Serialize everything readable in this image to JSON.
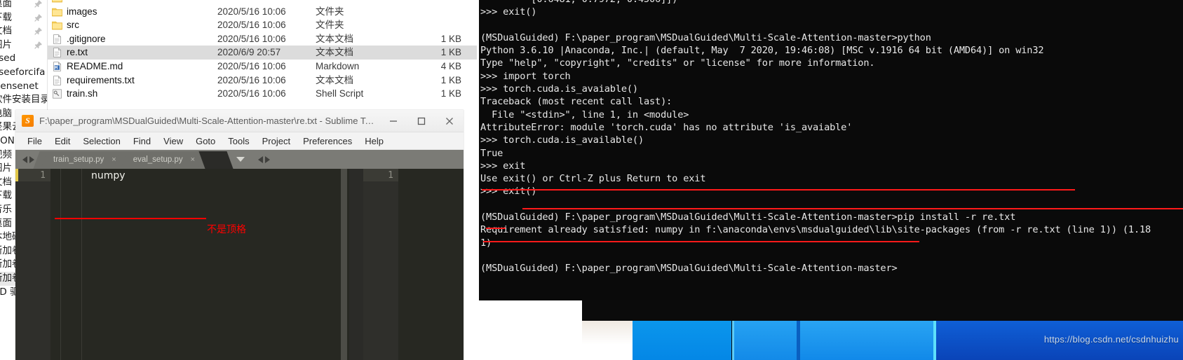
{
  "explorer": {
    "nav_items": [
      {
        "label": "桌面",
        "pinned": true,
        "selected": false
      },
      {
        "label": "下载",
        "pinned": true,
        "selected": false
      },
      {
        "label": "文档",
        "pinned": true,
        "selected": false
      },
      {
        "label": "图片",
        "pinned": true,
        "selected": false
      },
      {
        "label": "ased",
        "pinned": false,
        "selected": false
      },
      {
        "label": "aseeforcifa",
        "pinned": false,
        "selected": false
      },
      {
        "label": "Densenet",
        "pinned": false,
        "selected": false
      },
      {
        "label": "软件安装目录",
        "pinned": false,
        "selected": false
      },
      {
        "label": "电脑",
        "pinned": false,
        "selected": false
      },
      {
        "label": "坚果云",
        "pinned": false,
        "selected": false
      },
      {
        "label": "HON",
        "pinned": false,
        "selected": false
      },
      {
        "label": "视频",
        "pinned": false,
        "selected": false
      },
      {
        "label": "图片",
        "pinned": false,
        "selected": false
      },
      {
        "label": "文档",
        "pinned": false,
        "selected": false
      },
      {
        "label": "下载",
        "pinned": false,
        "selected": false
      },
      {
        "label": "音乐",
        "pinned": false,
        "selected": false
      },
      {
        "label": "桌面",
        "pinned": false,
        "selected": false
      },
      {
        "label": "本地磁盘",
        "pinned": false,
        "selected": false
      },
      {
        "label": "新加卷",
        "pinned": false,
        "selected": false
      },
      {
        "label": "新加卷",
        "pinned": false,
        "selected": false
      },
      {
        "label": "新加卷",
        "pinned": false,
        "selected": true
      },
      {
        "label": "CD 驱动器",
        "pinned": false,
        "selected": false
      }
    ],
    "files": [
      {
        "name": "",
        "date": "",
        "type": "",
        "size": "",
        "icon": "folder-icon",
        "selected": false,
        "partial": true
      },
      {
        "name": "images",
        "date": "2020/5/16 10:06",
        "type": "文件夹",
        "size": "",
        "icon": "folder-icon",
        "selected": false
      },
      {
        "name": "src",
        "date": "2020/5/16 10:06",
        "type": "文件夹",
        "size": "",
        "icon": "folder-icon",
        "selected": false
      },
      {
        "name": ".gitignore",
        "date": "2020/5/16 10:06",
        "type": "文本文档",
        "size": "1 KB",
        "icon": "text-file-icon",
        "selected": false
      },
      {
        "name": "re.txt",
        "date": "2020/6/9 20:57",
        "type": "文本文档",
        "size": "1 KB",
        "icon": "text-file-icon",
        "selected": true
      },
      {
        "name": "README.md",
        "date": "2020/5/16 10:06",
        "type": "Markdown",
        "size": "4 KB",
        "icon": "markdown-file-icon",
        "selected": false
      },
      {
        "name": "requirements.txt",
        "date": "2020/5/16 10:06",
        "type": "文本文档",
        "size": "1 KB",
        "icon": "text-file-icon",
        "selected": false
      },
      {
        "name": "train.sh",
        "date": "2020/5/16 10:06",
        "type": "Shell Script",
        "size": "1 KB",
        "icon": "shell-script-icon",
        "selected": false
      }
    ]
  },
  "sublime": {
    "title": "F:\\paper_program\\MSDualGuided\\Multi-Scale-Attention-master\\re.txt - Sublime Text (U...",
    "logo_glyph": "S",
    "menus": [
      "File",
      "Edit",
      "Selection",
      "Find",
      "View",
      "Goto",
      "Tools",
      "Project",
      "Preferences",
      "Help"
    ],
    "tabs": [
      {
        "label": "train_setup.py",
        "close": "×"
      },
      {
        "label": "eval_setup.py",
        "close": "×"
      }
    ],
    "left_pane": {
      "line_number": "1",
      "code": "numpy"
    },
    "right_pane": {
      "line_number": "1",
      "code": ""
    },
    "annotation_text": "不是顶格",
    "annotation_color": "#ff0000"
  },
  "terminal": {
    "lines": [
      "         [0.6481, 0.7972, 0.4506]])",
      ">>> exit()",
      "",
      "(MSDualGuided) F:\\paper_program\\MSDualGuided\\Multi-Scale-Attention-master>python",
      "Python 3.6.10 |Anaconda, Inc.| (default, May  7 2020, 19:46:08) [MSC v.1916 64 bit (AMD64)] on win32",
      "Type \"help\", \"copyright\", \"credits\" or \"license\" for more information.",
      ">>> import torch",
      ">>> torch.cuda.is_avaiable()",
      "Traceback (most recent call last):",
      "  File \"<stdin>\", line 1, in <module>",
      "AttributeError: module 'torch.cuda' has no attribute 'is_avaiable'",
      ">>> torch.cuda.is_available()",
      "True",
      ">>> exit",
      "Use exit() or Ctrl-Z plus Return to exit",
      ">>> exit()",
      "",
      "(MSDualGuided) F:\\paper_program\\MSDualGuided\\Multi-Scale-Attention-master>pip install -r re.txt",
      "Requirement already satisfied: numpy in f:\\anaconda\\envs\\msdualguided\\lib\\site-packages (from -r re.txt (line 1)) (1.18",
      "1)",
      "",
      "(MSDualGuided) F:\\paper_program\\MSDualGuided\\Multi-Scale-Attention-master>"
    ],
    "underline_color": "#ff1a1a"
  },
  "watermark": {
    "url": "https://blog.csdn.net/csdnhuizhu"
  },
  "colors": {
    "terminal_bg": "#0a0a0a",
    "sublime_bg": "#272822",
    "accent_red": "#ff0000",
    "taskbar_blue": "#0a84e0"
  }
}
